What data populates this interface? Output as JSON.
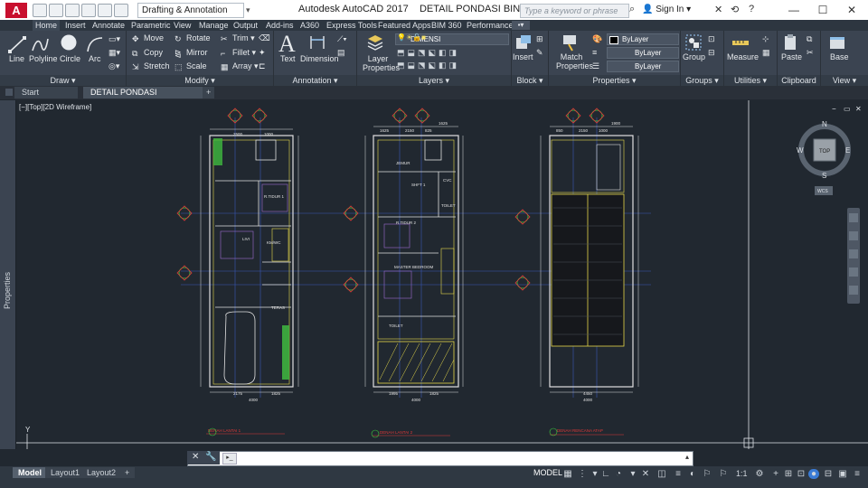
{
  "titlebar": {
    "logo_letter": "A",
    "workspace": "Drafting & Annotation",
    "app_name": "Autodesk AutoCAD 2017",
    "file_name": "DETAIL PONDASI BINTARO86.dwg",
    "search_placeholder": "Type a keyword or phrase",
    "sign_in": "Sign In",
    "minimize": "—",
    "maximize": "☐",
    "close": "✕"
  },
  "ribbon_tabs": [
    "Home",
    "Insert",
    "Annotate",
    "Parametric",
    "View",
    "Manage",
    "Output",
    "Add-ins",
    "A360",
    "Express Tools",
    "Featured Apps",
    "BIM 360",
    "Performance"
  ],
  "ribbon": {
    "draw": {
      "title": "Draw ▾",
      "line": "Line",
      "polyline": "Polyline",
      "circle": "Circle",
      "arc": "Arc"
    },
    "modify": {
      "title": "Modify ▾",
      "move": "Move",
      "rotate": "Rotate",
      "trim": "Trim ▾",
      "copy": "Copy",
      "mirror": "Mirror",
      "fillet": "Fillet ▾",
      "stretch": "Stretch",
      "scale": "Scale",
      "array": "Array ▾"
    },
    "annotation": {
      "title": "Annotation ▾",
      "text": "Text",
      "dimension": "Dimension"
    },
    "layers": {
      "title": "Layers ▾",
      "layer_properties": "Layer Properties",
      "current_layer": "DIMENSI"
    },
    "block": {
      "title": "Block ▾",
      "insert": "Insert"
    },
    "properties": {
      "title": "Properties ▾",
      "match": "Match Properties",
      "color": "ByLayer",
      "linetype": "ByLayer",
      "lineweight": "ByLayer"
    },
    "groups": {
      "title": "Groups ▾",
      "group": "Group"
    },
    "utilities": {
      "title": "Utilities ▾",
      "measure": "Measure"
    },
    "clipboard": {
      "title": "Clipboard",
      "paste": "Paste"
    },
    "view": {
      "title": "View ▾",
      "base": "Base"
    }
  },
  "doc_tabs": {
    "start": "Start",
    "active": "DETAIL PONDASI BINTARO86*",
    "add": "+"
  },
  "viewport_label": "[−][Top][2D Wireframe]",
  "side_palette": "Properties",
  "viewcube": {
    "n": "N",
    "s": "S",
    "e": "E",
    "w": "W",
    "top": "TOP",
    "wcs": "WCS"
  },
  "ucs": {
    "x": "X",
    "y": "Y"
  },
  "plan_labels": {
    "plan1": {
      "rooms": [
        "R.TIDUR 1",
        "LIVI",
        "KM/WC",
        "TERAS",
        "CARPORT"
      ],
      "dims_top": [
        "2500",
        "1000"
      ],
      "dims_bottom": [
        "2175",
        "1825",
        "4000"
      ],
      "dims_side": [
        "1500",
        "3500",
        "1200",
        "4500",
        "2850"
      ],
      "caption": "DENAH LANTAI 1"
    },
    "plan2": {
      "rooms": [
        "JEMUR",
        "SHFT 1",
        "CVC",
        "TOILET",
        "R.TIDUR 2",
        "MASTER BEDROOM",
        "TOILET"
      ],
      "dims_top": [
        "1625",
        "2150",
        "825",
        "1625"
      ],
      "dims_bottom": [
        "1995",
        "1825",
        "4000"
      ],
      "dims_side": [
        "1550",
        "3500",
        "3700",
        "4700",
        "2175"
      ],
      "caption": "DENAH LANTAI 2"
    },
    "plan3": {
      "dims_top": [
        "850",
        "2150",
        "1000",
        "1900"
      ],
      "dims_bottom": [
        "4450",
        "4000"
      ],
      "dims_side": [
        "1000",
        "5500",
        "4050",
        "2175"
      ],
      "caption": "DENAH RENCANA ATAP"
    }
  },
  "status": {
    "layout_tabs": [
      "Model",
      "Layout1",
      "Layout2"
    ],
    "add_layout": "+",
    "model": "MODEL",
    "scale": "1:1"
  }
}
